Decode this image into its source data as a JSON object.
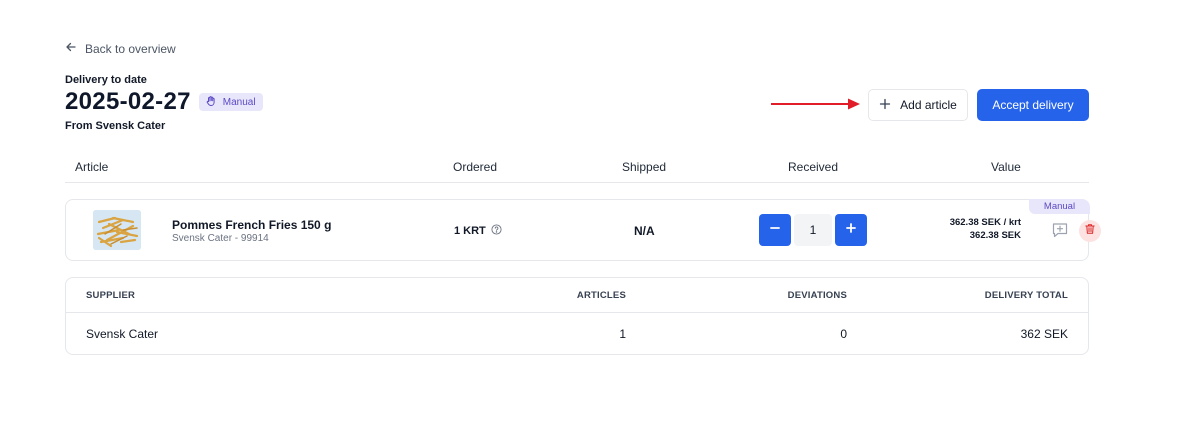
{
  "nav": {
    "back_label": "Back to overview"
  },
  "header": {
    "subtitle": "Delivery to date",
    "date": "2025-02-27",
    "badge": "Manual",
    "from": "From Svensk Cater"
  },
  "actions": {
    "add_label": "Add article",
    "accept_label": "Accept delivery"
  },
  "table": {
    "columns": [
      "Article",
      "Ordered",
      "Shipped",
      "Received",
      "Value"
    ],
    "rows": [
      {
        "name": "Pommes French Fries 150 g",
        "sub": "Svensk Cater - 99914",
        "ordered": "1 KRT",
        "shipped": "N/A",
        "received": "1",
        "unit_price": "362.38 SEK / krt",
        "total": "362.38 SEK",
        "badge": "Manual"
      }
    ]
  },
  "summary": {
    "headers": [
      "SUPPLIER",
      "ARTICLES",
      "DEVIATIONS",
      "DELIVERY TOTAL"
    ],
    "values": [
      "Svensk Cater",
      "1",
      "0",
      "362 SEK"
    ]
  },
  "colors": {
    "primary": "#2563eb",
    "badge_bg": "#e8e6fb",
    "badge_text": "#5b4bc4",
    "annotation_arrow": "#e11d2a",
    "delete_bg": "#fde2e2",
    "delete_icon": "#dc2626"
  },
  "icons": {
    "back": "arrow-left-icon",
    "badge": "hand-icon",
    "add": "plus-icon",
    "ordered_info": "help-circle-icon",
    "decrement": "minus-icon",
    "increment": "plus-icon",
    "comment": "message-plus-icon",
    "delete": "trash-icon"
  }
}
